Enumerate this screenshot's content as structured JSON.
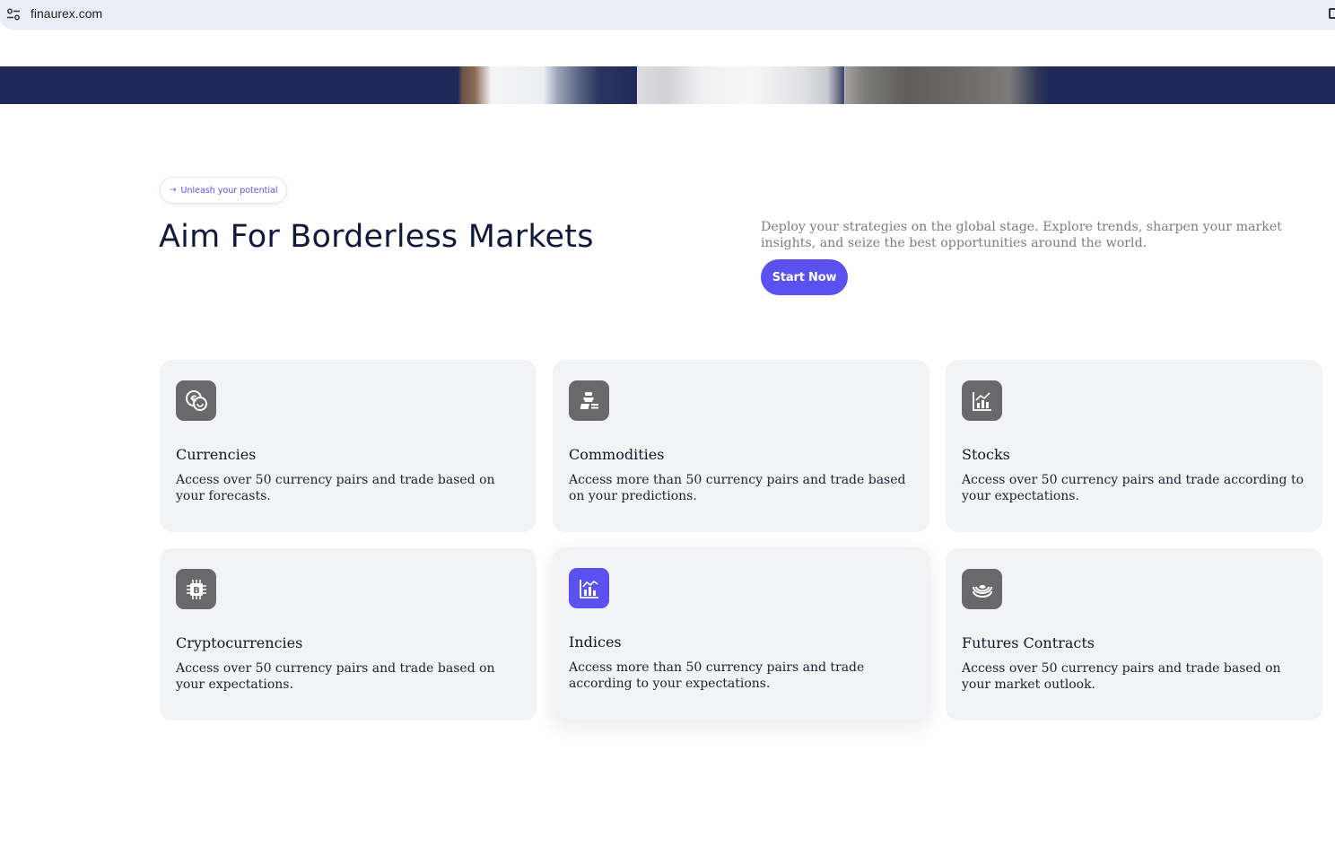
{
  "browser": {
    "url": "finaurex.com",
    "site_info_icon": "tune-icon"
  },
  "hero": {
    "background_color": "#1f2a5a"
  },
  "section": {
    "pill_text": "Unleash your potential",
    "pill_icon": "arrow-right-icon",
    "title": "Aim For Borderless Markets",
    "description": "Deploy your strategies on the global stage. Explore trends, sharpen your market insights, and seize the best opportunities around the world.",
    "cta_label": "Start Now"
  },
  "colors": {
    "accent": "#5b50f0",
    "icon_bg": "#69696b",
    "card_bg": "#f2f3f5",
    "title": "#13193a"
  },
  "cards": [
    {
      "title": "Currencies",
      "text": "Access over 50 currency pairs and trade based on your forecasts.",
      "icon": "euro-coins-icon",
      "active": false
    },
    {
      "title": "Commodities",
      "text": "Access more than 50 currency pairs and trade based on your predictions.",
      "icon": "gold-bars-icon",
      "active": false
    },
    {
      "title": "Stocks",
      "text": "Access over 50 currency pairs and trade according to your expectations.",
      "icon": "stock-chart-icon",
      "active": false
    },
    {
      "title": "Cryptocurrencies",
      "text": "Access over 50 currency pairs and trade based on your expectations.",
      "icon": "bitcoin-chip-icon",
      "active": false
    },
    {
      "title": "Indices",
      "text": "Access more than 50 currency pairs and trade according to your expectations.",
      "icon": "index-chart-icon",
      "active": true
    },
    {
      "title": "Futures Contracts",
      "text": "Access over 50 currency pairs and trade based on your market outlook.",
      "icon": "futures-rings-icon",
      "active": false
    }
  ]
}
